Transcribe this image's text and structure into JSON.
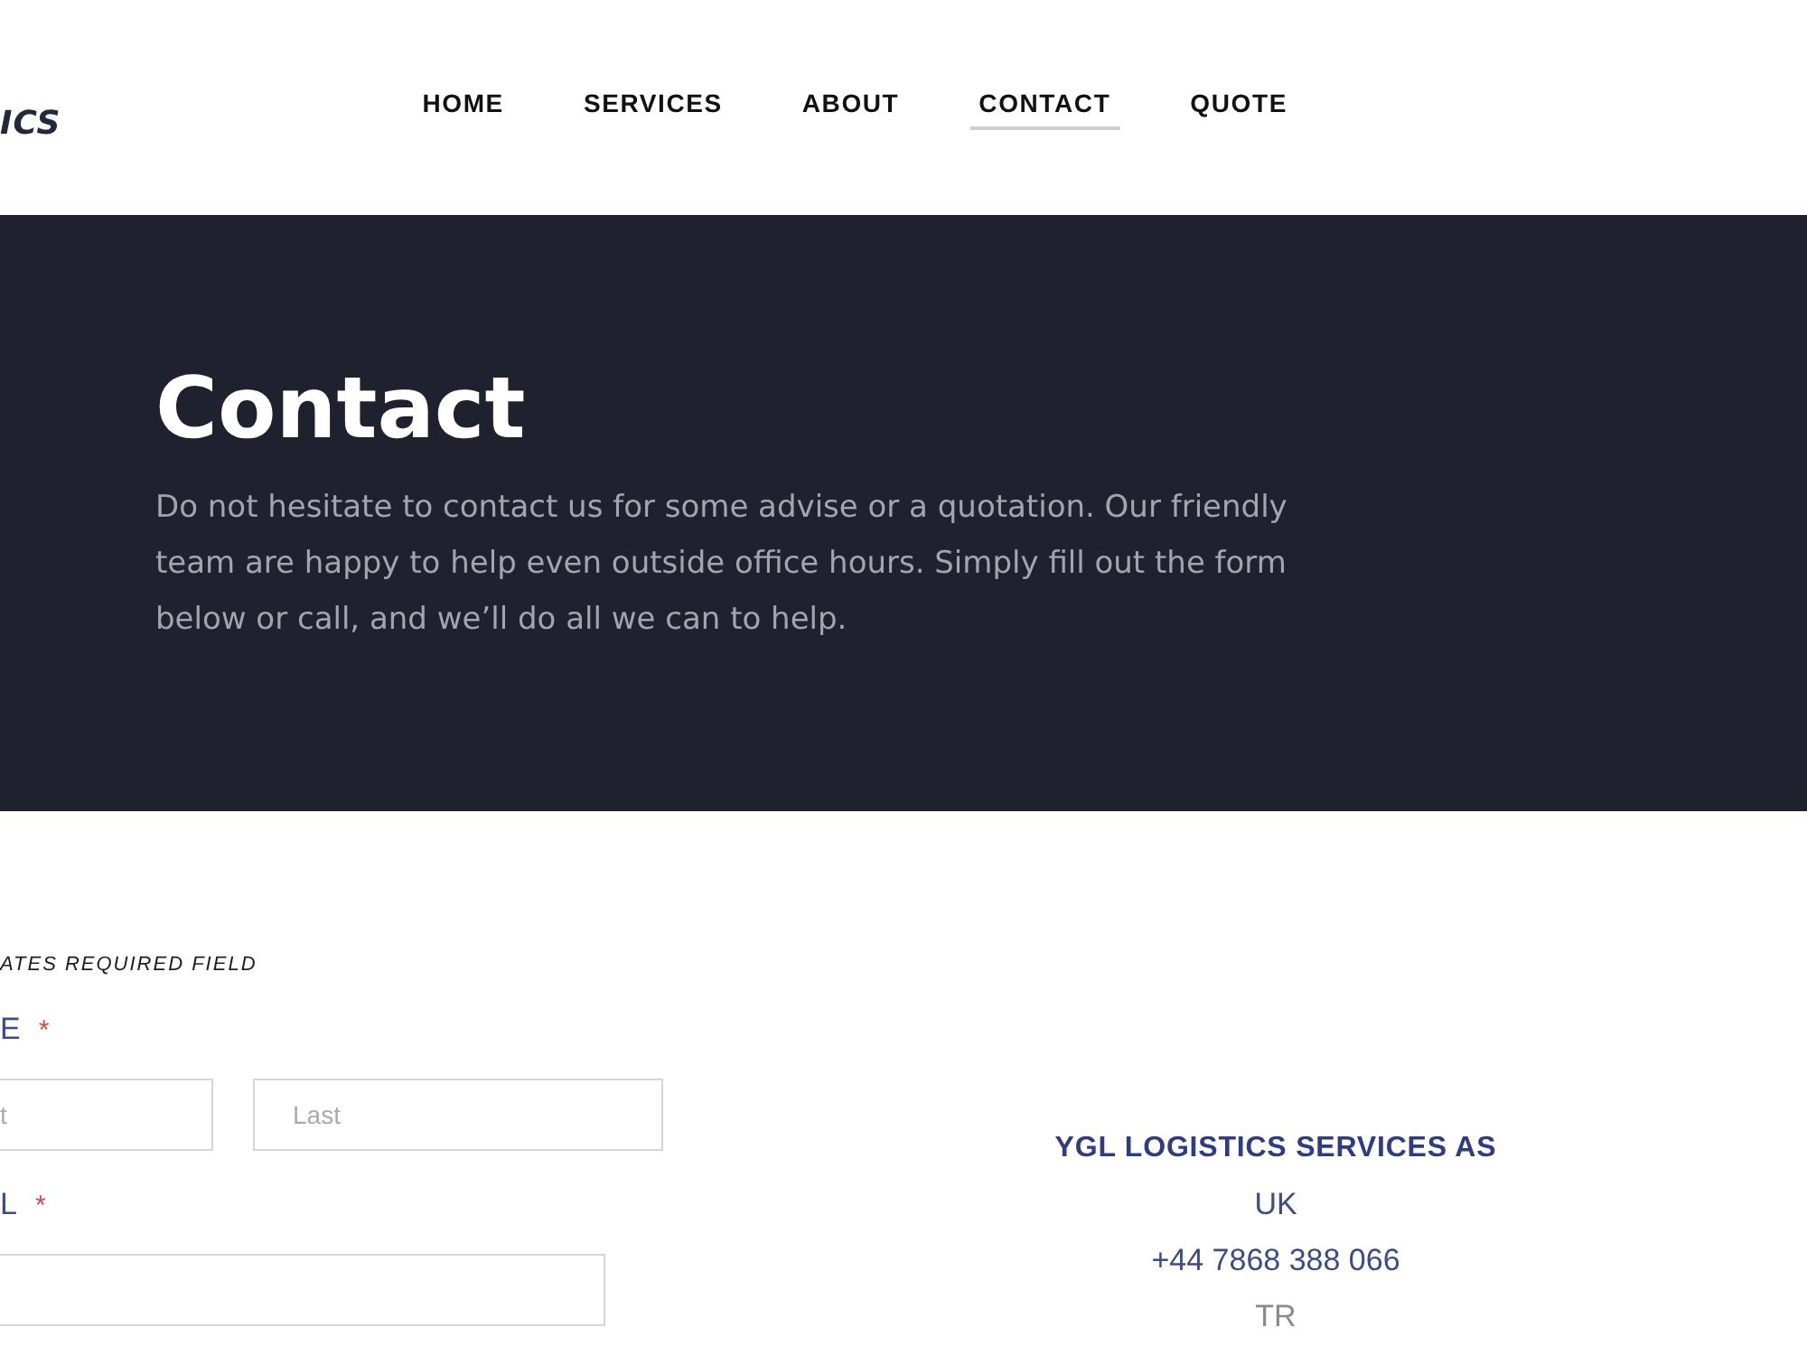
{
  "header": {
    "logo": "ICS",
    "nav": [
      {
        "label": "HOME",
        "selected": false
      },
      {
        "label": "SERVICES",
        "selected": false
      },
      {
        "label": "ABOUT",
        "selected": false
      },
      {
        "label": "CONTACT",
        "selected": true
      },
      {
        "label": "QUOTE",
        "selected": false
      }
    ]
  },
  "hero": {
    "title": "Contact",
    "text": "Do not hesitate to contact us for some advise or a quotation. Our friendly team are happy to help even outside office hours. Simply fill out the form below or call, and we’ll do all we can to help."
  },
  "form": {
    "required_note": "ATES REQUIRED FIELD",
    "fields": [
      {
        "label": "E",
        "mark": "*",
        "inputs": [
          {
            "kind": "cut",
            "placeholder": "t"
          },
          {
            "kind": "whole",
            "placeholder": "Last"
          }
        ]
      },
      {
        "label": "L",
        "mark": "*",
        "inputs": [
          {
            "kind": "cut"
          }
        ]
      }
    ]
  },
  "contact_info": {
    "lines": [
      {
        "kind": "heading",
        "text": "YGL LOGISTICS SERVICES AS"
      },
      {
        "kind": "highlight",
        "text": "UK"
      },
      {
        "kind": "highlight",
        "text": "+44 7868 388 066"
      },
      {
        "kind": "muted",
        "text": "TR"
      }
    ]
  }
}
